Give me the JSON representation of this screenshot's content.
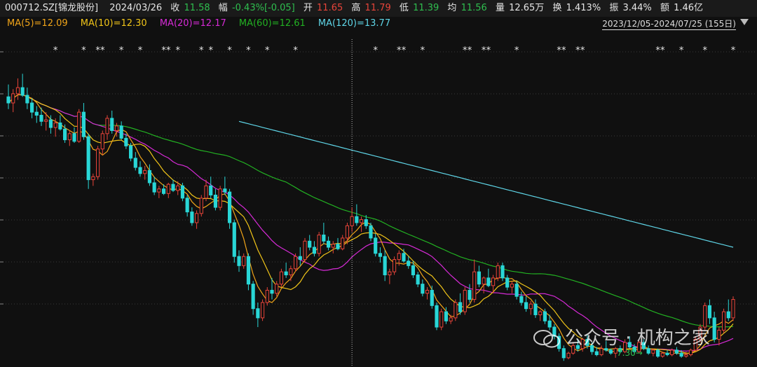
{
  "info": {
    "code": "000712.SZ[锦龙股份]",
    "date": "2024/03/26",
    "close_label": "收",
    "close": "11.58",
    "chg_label": "幅",
    "chg": "-0.43%[-0.05]",
    "open_label": "开",
    "open": "11.65",
    "high_label": "高",
    "high": "11.79",
    "low_label": "低",
    "low": "11.39",
    "avg_label": "均",
    "avg": "11.56",
    "vol_label": "量",
    "vol": "12.65万",
    "turn_label": "换",
    "turn": "1.413%",
    "amp_label": "振",
    "amp": "3.44%",
    "amt_label": "额",
    "amt": "1.46亿"
  },
  "ma": {
    "ma5": "MA(5)=12.09",
    "ma10": "MA(10)=12.30",
    "ma20": "MA(20)=12.17",
    "ma60": "MA(60)=12.61",
    "ma120": "MA(120)=13.77"
  },
  "range": "2023/12/05-2024/07/25 (155日)",
  "low_marker": "7.30",
  "watermark": "公众号 · 机构之家",
  "colors": {
    "up": "#e8443a",
    "down": "#29d6d6",
    "ma5": "#f0c419",
    "ma10": "#f0c419",
    "ma20": "#d62ad6",
    "ma60": "#22b022",
    "ma120": "#5fd6e8"
  },
  "chart_data": {
    "type": "candlestick",
    "x_range": [
      "2023/12/05",
      "2024/07/25"
    ],
    "n_bars": 155,
    "ylim": [
      7.0,
      16.9
    ],
    "selected_index": 73,
    "star_indices": [
      10,
      16,
      19,
      20,
      24,
      28,
      33,
      34,
      36,
      41,
      43,
      47,
      51,
      55,
      61,
      78,
      83,
      84,
      88,
      97,
      98,
      101,
      102,
      108,
      117,
      118,
      121,
      122,
      138,
      139,
      143,
      148,
      154
    ],
    "ohlc": [
      [
        15.8,
        16.2,
        15.4,
        15.6
      ],
      [
        15.6,
        16.05,
        15.3,
        15.9
      ],
      [
        15.9,
        16.4,
        15.7,
        16.1
      ],
      [
        16.1,
        16.55,
        15.8,
        15.85
      ],
      [
        15.85,
        16.1,
        15.4,
        15.6
      ],
      [
        15.6,
        15.75,
        15.1,
        15.3
      ],
      [
        15.3,
        15.5,
        14.95,
        15.2
      ],
      [
        15.2,
        15.45,
        14.85,
        15.0
      ],
      [
        15.0,
        15.3,
        14.7,
        15.05
      ],
      [
        15.05,
        15.2,
        14.6,
        14.8
      ],
      [
        14.8,
        15.1,
        14.5,
        14.95
      ],
      [
        14.95,
        15.2,
        14.7,
        14.75
      ],
      [
        14.75,
        14.9,
        14.3,
        14.4
      ],
      [
        14.4,
        14.7,
        14.2,
        14.6
      ],
      [
        14.6,
        14.8,
        14.3,
        14.35
      ],
      [
        14.35,
        15.4,
        14.3,
        15.3
      ],
      [
        15.3,
        15.6,
        14.4,
        14.5
      ],
      [
        14.5,
        14.6,
        12.8,
        13.1
      ],
      [
        13.1,
        13.3,
        12.9,
        13.2
      ],
      [
        13.2,
        14.2,
        13.1,
        14.1
      ],
      [
        14.1,
        14.7,
        13.9,
        14.6
      ],
      [
        14.6,
        15.2,
        14.4,
        15.1
      ],
      [
        15.1,
        15.35,
        14.6,
        14.7
      ],
      [
        14.7,
        14.95,
        14.5,
        14.85
      ],
      [
        14.85,
        15.0,
        14.4,
        14.45
      ],
      [
        14.45,
        14.6,
        14.1,
        14.2
      ],
      [
        14.2,
        14.3,
        13.7,
        13.8
      ],
      [
        13.8,
        14.0,
        13.4,
        13.5
      ],
      [
        13.5,
        13.7,
        13.2,
        13.3
      ],
      [
        13.3,
        13.55,
        13.1,
        13.4
      ],
      [
        13.4,
        13.6,
        12.9,
        13.0
      ],
      [
        13.0,
        13.2,
        12.6,
        12.7
      ],
      [
        12.7,
        12.9,
        12.5,
        12.8
      ],
      [
        12.8,
        12.95,
        12.6,
        12.65
      ],
      [
        12.65,
        13.0,
        12.5,
        12.95
      ],
      [
        12.95,
        13.1,
        12.7,
        12.75
      ],
      [
        12.75,
        13.05,
        12.6,
        12.9
      ],
      [
        12.9,
        13.0,
        12.4,
        12.5
      ],
      [
        12.5,
        12.6,
        11.9,
        12.05
      ],
      [
        12.05,
        12.2,
        11.6,
        11.7
      ],
      [
        11.7,
        12.1,
        11.5,
        12.0
      ],
      [
        12.0,
        12.6,
        11.9,
        12.5
      ],
      [
        12.5,
        13.1,
        12.4,
        12.9
      ],
      [
        12.9,
        13.2,
        12.5,
        12.6
      ],
      [
        12.6,
        12.8,
        12.1,
        12.2
      ],
      [
        12.2,
        12.9,
        12.1,
        12.8
      ],
      [
        12.8,
        13.2,
        12.6,
        12.7
      ],
      [
        12.7,
        12.8,
        11.5,
        11.7
      ],
      [
        11.7,
        11.8,
        10.4,
        10.6
      ],
      [
        10.6,
        10.8,
        10.1,
        10.3
      ],
      [
        10.3,
        10.7,
        10.2,
        10.6
      ],
      [
        10.6,
        10.7,
        9.5,
        9.7
      ],
      [
        9.7,
        9.8,
        8.7,
        8.9
      ],
      [
        8.9,
        9.1,
        8.3,
        8.6
      ],
      [
        8.6,
        9.2,
        8.5,
        9.1
      ],
      [
        9.1,
        9.6,
        9.0,
        9.5
      ],
      [
        9.5,
        9.9,
        9.2,
        9.4
      ],
      [
        9.4,
        9.8,
        9.3,
        9.7
      ],
      [
        9.7,
        10.2,
        9.6,
        10.1
      ],
      [
        10.1,
        10.4,
        9.9,
        10.0
      ],
      [
        10.0,
        10.3,
        9.8,
        10.2
      ],
      [
        10.2,
        10.7,
        10.1,
        10.6
      ],
      [
        10.6,
        10.9,
        10.3,
        10.5
      ],
      [
        10.5,
        11.2,
        10.4,
        11.1
      ],
      [
        11.1,
        11.3,
        10.8,
        10.9
      ],
      [
        10.9,
        11.1,
        10.6,
        10.7
      ],
      [
        10.7,
        11.4,
        10.6,
        11.3
      ],
      [
        11.3,
        11.7,
        11.0,
        11.1
      ],
      [
        11.1,
        11.25,
        10.8,
        10.9
      ],
      [
        10.9,
        11.1,
        10.7,
        11.0
      ],
      [
        11.0,
        11.2,
        10.8,
        10.85
      ],
      [
        10.85,
        11.3,
        10.8,
        11.2
      ],
      [
        11.2,
        11.7,
        11.0,
        11.6
      ],
      [
        11.6,
        12.2,
        11.4,
        11.9
      ],
      [
        11.9,
        12.3,
        11.6,
        11.7
      ],
      [
        11.7,
        11.9,
        11.4,
        11.8
      ],
      [
        11.8,
        11.95,
        11.5,
        11.6
      ],
      [
        11.6,
        11.7,
        11.1,
        11.2
      ],
      [
        11.2,
        11.35,
        10.6,
        10.7
      ],
      [
        10.7,
        10.9,
        10.4,
        10.6
      ],
      [
        10.6,
        10.8,
        9.8,
        10.0
      ],
      [
        10.0,
        10.2,
        9.7,
        10.1
      ],
      [
        10.1,
        10.6,
        10.0,
        10.5
      ],
      [
        10.5,
        10.8,
        10.3,
        10.7
      ],
      [
        10.7,
        10.85,
        10.4,
        10.45
      ],
      [
        10.45,
        10.6,
        10.2,
        10.3
      ],
      [
        10.3,
        10.45,
        9.9,
        10.0
      ],
      [
        10.0,
        10.1,
        9.6,
        9.7
      ],
      [
        9.7,
        9.85,
        9.3,
        9.4
      ],
      [
        9.4,
        9.6,
        9.2,
        9.5
      ],
      [
        9.5,
        9.65,
        8.9,
        9.0
      ],
      [
        9.0,
        9.1,
        8.2,
        8.3
      ],
      [
        8.3,
        8.9,
        8.2,
        8.8
      ],
      [
        8.8,
        8.95,
        8.4,
        8.5
      ],
      [
        8.5,
        8.7,
        8.4,
        8.6
      ],
      [
        8.6,
        9.2,
        8.5,
        9.1
      ],
      [
        9.1,
        9.4,
        8.7,
        8.8
      ],
      [
        8.8,
        9.6,
        8.7,
        9.5
      ],
      [
        9.5,
        9.7,
        9.1,
        9.2
      ],
      [
        9.2,
        10.5,
        9.1,
        10.1
      ],
      [
        10.1,
        10.3,
        9.6,
        9.7
      ],
      [
        9.7,
        9.95,
        9.4,
        9.9
      ],
      [
        9.9,
        10.2,
        9.6,
        9.65
      ],
      [
        9.65,
        10.0,
        9.4,
        9.9
      ],
      [
        9.9,
        10.4,
        9.8,
        10.3
      ],
      [
        10.3,
        10.4,
        9.8,
        9.9
      ],
      [
        9.9,
        10.0,
        9.5,
        9.6
      ],
      [
        9.6,
        9.8,
        9.4,
        9.7
      ],
      [
        9.7,
        9.8,
        9.2,
        9.3
      ],
      [
        9.3,
        9.45,
        9.0,
        9.1
      ],
      [
        9.1,
        9.3,
        8.8,
        8.9
      ],
      [
        8.9,
        9.15,
        8.7,
        9.05
      ],
      [
        9.05,
        9.2,
        8.6,
        8.7
      ],
      [
        8.7,
        8.85,
        8.5,
        8.8
      ],
      [
        8.8,
        8.9,
        8.4,
        8.5
      ],
      [
        8.5,
        8.7,
        8.2,
        8.3
      ],
      [
        8.3,
        8.4,
        7.9,
        8.0
      ],
      [
        8.0,
        8.1,
        7.5,
        7.6
      ],
      [
        7.6,
        7.7,
        7.2,
        7.3
      ],
      [
        7.3,
        7.5,
        7.25,
        7.45
      ],
      [
        7.45,
        7.8,
        7.4,
        7.7
      ],
      [
        7.7,
        7.9,
        7.5,
        7.6
      ],
      [
        7.6,
        7.95,
        7.5,
        7.9
      ],
      [
        7.9,
        8.05,
        7.6,
        7.7
      ],
      [
        7.7,
        7.8,
        7.4,
        7.5
      ],
      [
        7.5,
        7.65,
        7.35,
        7.4
      ],
      [
        7.4,
        7.7,
        7.35,
        7.6
      ],
      [
        7.6,
        7.85,
        7.5,
        7.55
      ],
      [
        7.55,
        7.6,
        7.4,
        7.45
      ],
      [
        7.45,
        7.65,
        7.3,
        7.6
      ],
      [
        7.6,
        7.7,
        7.45,
        7.5
      ],
      [
        7.5,
        7.9,
        7.45,
        7.8
      ],
      [
        7.8,
        8.0,
        7.6,
        7.65
      ],
      [
        7.65,
        7.75,
        7.4,
        7.5
      ],
      [
        7.5,
        7.85,
        7.45,
        7.8
      ],
      [
        7.8,
        7.9,
        7.55,
        7.6
      ],
      [
        7.6,
        7.7,
        7.4,
        7.45
      ],
      [
        7.45,
        7.6,
        7.35,
        7.55
      ],
      [
        7.55,
        7.6,
        7.3,
        7.35
      ],
      [
        7.35,
        7.5,
        7.3,
        7.45
      ],
      [
        7.45,
        7.55,
        7.35,
        7.4
      ],
      [
        7.4,
        7.6,
        7.35,
        7.55
      ],
      [
        7.55,
        7.65,
        7.4,
        7.45
      ],
      [
        7.45,
        7.55,
        7.3,
        7.35
      ],
      [
        7.35,
        7.5,
        7.3,
        7.4
      ],
      [
        7.4,
        7.6,
        7.35,
        7.55
      ],
      [
        7.55,
        8.0,
        7.5,
        7.9
      ],
      [
        7.9,
        8.4,
        7.8,
        8.3
      ],
      [
        8.3,
        9.1,
        8.2,
        9.0
      ],
      [
        9.0,
        9.2,
        8.4,
        8.6
      ],
      [
        8.6,
        8.8,
        7.8,
        7.9
      ],
      [
        7.9,
        8.3,
        7.7,
        8.2
      ],
      [
        8.2,
        8.9,
        8.1,
        8.8
      ],
      [
        8.8,
        9.2,
        8.5,
        8.6
      ],
      [
        8.6,
        9.3,
        8.5,
        9.2
      ]
    ],
    "ma120_start": [
      49,
      15.0
    ],
    "ma120_end": [
      154,
      10.9
    ]
  }
}
